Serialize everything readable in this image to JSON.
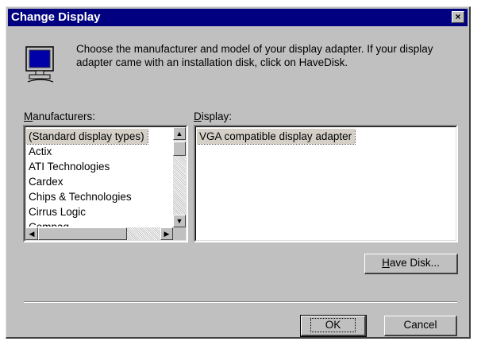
{
  "window": {
    "title": "Change Display",
    "close_glyph": "×"
  },
  "instructions": "Choose the manufacturer and model of your display adapter.  If your display adapter came with an installation disk, click on HaveDisk.",
  "manufacturers": {
    "label_accel": "M",
    "label_rest": "anufacturers:",
    "items": [
      "(Standard display types)",
      "Actix",
      "ATI Technologies",
      "Cardex",
      "Chips & Technologies",
      "Cirrus Logic",
      "Compaq"
    ],
    "selected_index": 0
  },
  "display": {
    "label_accel": "D",
    "label_rest": "isplay:",
    "items": [
      "VGA compatible display adapter"
    ],
    "selected_index": 0
  },
  "buttons": {
    "have_disk_accel": "H",
    "have_disk_rest": "ave Disk...",
    "ok": "OK",
    "cancel": "Cancel"
  },
  "icons": {
    "monitor": "monitor-icon",
    "close": "close-icon"
  },
  "colors": {
    "titlebar": "#000080",
    "face": "#c0c0c0"
  }
}
